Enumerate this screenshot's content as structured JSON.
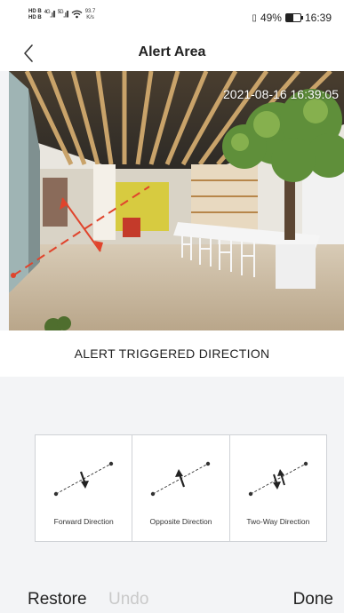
{
  "status_bar": {
    "hd1": "HD B",
    "hd2": "HD B",
    "net1": "4G",
    "net2": "5G",
    "speed_value": "93.7",
    "speed_unit": "K/s",
    "battery_text": "49%",
    "battery_level_percent": 49,
    "time": "16:39"
  },
  "header": {
    "title": "Alert Area"
  },
  "camera": {
    "timestamp": "2021-08-16 16:39:05",
    "alert_line_color": "#e0442c"
  },
  "section": {
    "title": "ALERT TRIGGERED DIRECTION"
  },
  "directions": [
    {
      "label": "Forward Direction",
      "icon": "forward-direction-icon"
    },
    {
      "label": "Opposite Direction",
      "icon": "opposite-direction-icon"
    },
    {
      "label": "Two-Way Direction",
      "icon": "two-way-direction-icon"
    }
  ],
  "footer": {
    "restore": "Restore",
    "undo": "Undo",
    "done": "Done"
  }
}
